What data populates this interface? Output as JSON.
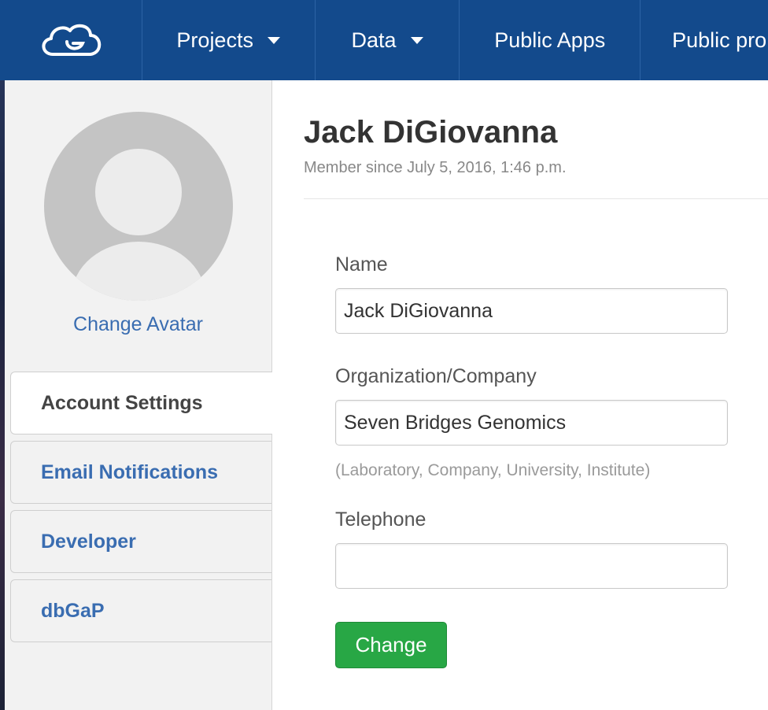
{
  "nav": {
    "logo": "cloud-logo-icon",
    "items": [
      {
        "label": "Projects",
        "dropdown": true
      },
      {
        "label": "Data",
        "dropdown": true
      },
      {
        "label": "Public Apps",
        "dropdown": false
      },
      {
        "label": "Public pro",
        "dropdown": false
      }
    ]
  },
  "sidebar": {
    "change_avatar": "Change Avatar",
    "tabs": [
      {
        "label": "Account Settings",
        "active": true
      },
      {
        "label": "Email Notifications",
        "active": false
      },
      {
        "label": "Developer",
        "active": false
      },
      {
        "label": "dbGaP",
        "active": false
      }
    ]
  },
  "profile": {
    "name": "Jack DiGiovanna",
    "member_since": "Member since July 5, 2016, 1:46 p.m."
  },
  "form": {
    "name_label": "Name",
    "name_value": "Jack DiGiovanna",
    "org_label": "Organization/Company",
    "org_value": "Seven Bridges Genomics",
    "org_help": "(Laboratory, Company, University, Institute)",
    "phone_label": "Telephone",
    "phone_value": "",
    "submit_label": "Change"
  },
  "colors": {
    "navbar": "#134a8c",
    "link": "#3a6db1",
    "button": "#28a745"
  }
}
